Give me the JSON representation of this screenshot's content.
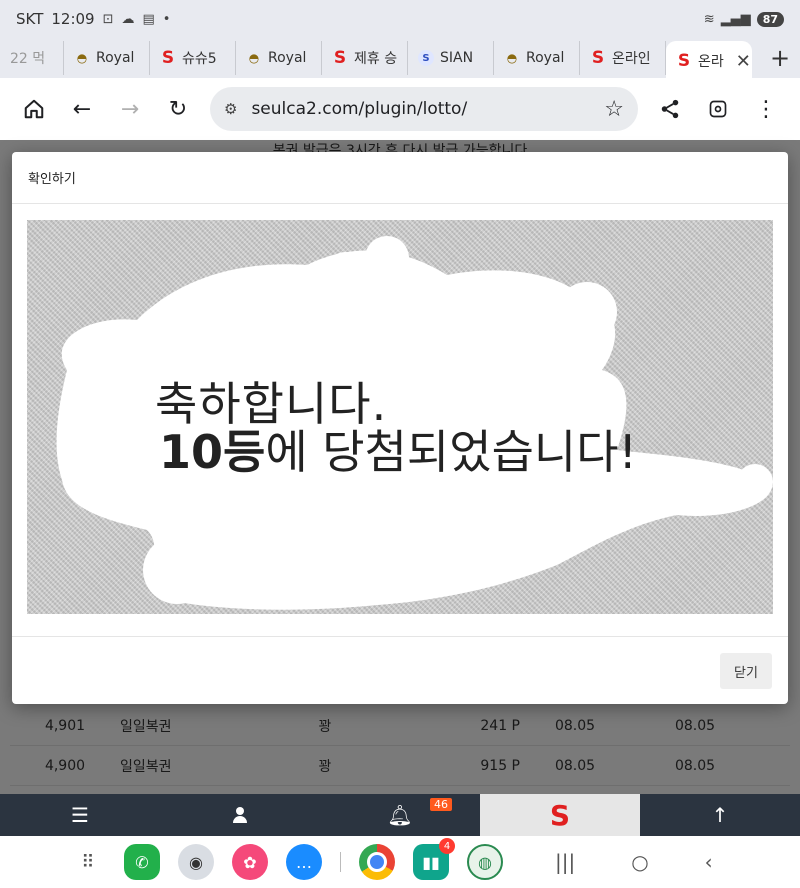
{
  "status_bar": {
    "carrier": "SKT",
    "time": "12:09",
    "battery": "87"
  },
  "tabs": [
    {
      "label": "22 먹",
      "favicon": "none"
    },
    {
      "label": "Royal",
      "favicon": "royal-icon"
    },
    {
      "label": "슈슈5",
      "favicon": "s-logo-icon"
    },
    {
      "label": "Royal",
      "favicon": "royal-icon"
    },
    {
      "label": "제휴 승",
      "favicon": "s-logo-icon"
    },
    {
      "label": "SIAN",
      "favicon": "sian-icon"
    },
    {
      "label": "Royal",
      "favicon": "royal-icon"
    },
    {
      "label": "온라인",
      "favicon": "s-logo-icon"
    },
    {
      "label": "온라",
      "favicon": "s-logo-icon",
      "active": true
    }
  ],
  "toolbar": {
    "url": "seulca2.com/plugin/lotto/"
  },
  "page": {
    "top_text": "복권 발급은 3시간 후 다시 발급 가능합니다",
    "rows": [
      {
        "no": "4,901",
        "name": "일일복권",
        "result": "꽝",
        "points": "241 P",
        "date1": "08.05",
        "date2": "08.05"
      },
      {
        "no": "4,900",
        "name": "일일복권",
        "result": "꽝",
        "points": "915 P",
        "date1": "08.05",
        "date2": "08.05"
      }
    ]
  },
  "modal": {
    "title": "확인하기",
    "line1": "축하합니다.",
    "rank": "10등",
    "line2_rest": "에 당첨되었습니다!",
    "close_label": "닫기"
  },
  "site_nav": {
    "notification_count": "46",
    "logo": "S"
  },
  "dock": {
    "stock_badge": "4"
  },
  "colors": {
    "nav_bg": "#2b3440",
    "brand_red": "#e02020",
    "badge_orange": "#ff5a1e"
  }
}
